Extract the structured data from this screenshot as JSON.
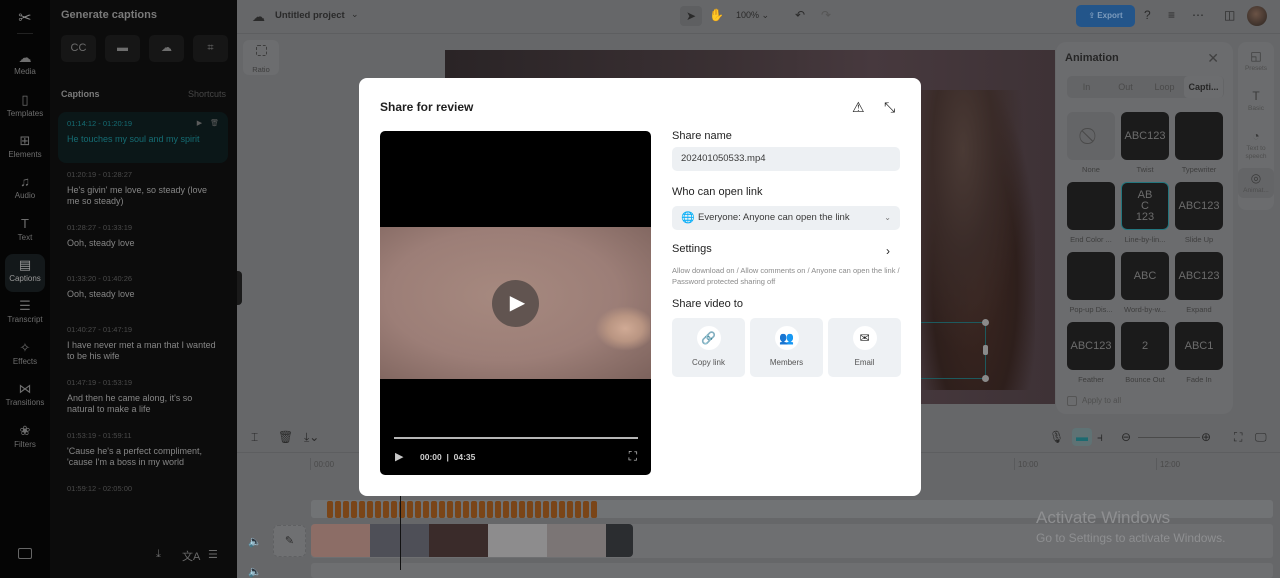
{
  "rail": {
    "items": [
      {
        "label": "Media",
        "icon": "media-upload-icon",
        "glyph": "☁"
      },
      {
        "label": "Templates",
        "icon": "templates-icon",
        "glyph": "▯"
      },
      {
        "label": "Elements",
        "icon": "elements-icon",
        "glyph": "⊞"
      },
      {
        "label": "Audio",
        "icon": "audio-icon",
        "glyph": "♫"
      },
      {
        "label": "Text",
        "icon": "text-icon",
        "glyph": "T"
      },
      {
        "label": "Captions",
        "icon": "captions-icon",
        "glyph": "▤",
        "active": true
      },
      {
        "label": "Transcript",
        "icon": "transcript-icon",
        "glyph": "☰"
      },
      {
        "label": "Effects",
        "icon": "effects-icon",
        "glyph": "✧"
      },
      {
        "label": "Transitions",
        "icon": "transitions-icon",
        "glyph": "⋈"
      },
      {
        "label": "Filters",
        "icon": "filters-icon",
        "glyph": "❀"
      }
    ]
  },
  "captions_panel": {
    "title": "Generate captions",
    "gen_buttons": [
      {
        "icon": "auto-captions-icon",
        "glyph": "CC"
      },
      {
        "icon": "manual-captions-icon",
        "glyph": "▬"
      },
      {
        "icon": "upload-captions-icon",
        "glyph": "☁"
      },
      {
        "icon": "scan-captions-icon",
        "glyph": "⌗"
      }
    ],
    "heading": "Captions",
    "shortcuts": "Shortcuts",
    "items": [
      {
        "time": "01:14:12 - 01:20:19",
        "text": "He touches my soul and my spirit",
        "active": true
      },
      {
        "time": "01:20:19 - 01:28:27",
        "text": "He's givin' me love, so steady (love me so steady)"
      },
      {
        "time": "01:28:27 - 01:33:19",
        "text": "Ooh, steady love"
      },
      {
        "time": "01:33:20 - 01:40:26",
        "text": "Ooh, steady love"
      },
      {
        "time": "01:40:27 - 01:47:19",
        "text": "I have never met a man that I wanted to be his wife"
      },
      {
        "time": "01:47:19 - 01:53:19",
        "text": "And then he came along, it's so natural to make a life"
      },
      {
        "time": "01:53:19 - 01:59:11",
        "text": "'Cause he's a perfect compliment, 'cause I'm a boss in my world"
      },
      {
        "time": "01:59:12 - 02:05:00",
        "text": ""
      }
    ],
    "play_glyph": "▶",
    "delete_glyph": "🗑"
  },
  "topbar": {
    "project_name": "Untitled project",
    "zoom": "100%",
    "export_label": "Export"
  },
  "canvas": {
    "ratio_label": "Ratio"
  },
  "animation_panel": {
    "title": "Animation",
    "tabs": [
      "In",
      "Out",
      "Loop",
      "Capti..."
    ],
    "active_tab": 3,
    "tiles": [
      {
        "label": "None",
        "preview": "⃠"
      },
      {
        "label": "Twist",
        "preview": "ABC123"
      },
      {
        "label": "Typewriter",
        "preview": ""
      },
      {
        "label": "End Color ...",
        "preview": ""
      },
      {
        "label": "Line-by-lin...",
        "preview": "AB\nC\n123",
        "selected": true
      },
      {
        "label": "Slide Up",
        "preview": "ABC123"
      },
      {
        "label": "Pop-up Dis...",
        "preview": ""
      },
      {
        "label": "Word-by-w...",
        "preview": "ABC"
      },
      {
        "label": "Expand",
        "preview": "ABC123"
      },
      {
        "label": "Feather",
        "preview": "ABC123"
      },
      {
        "label": "Bounce Out",
        "preview": "2"
      },
      {
        "label": "Fade In",
        "preview": "ABC1"
      }
    ],
    "apply_all": "Apply to all"
  },
  "right_tools": [
    {
      "label": "Presets",
      "icon": "presets-icon",
      "glyph": "◱"
    },
    {
      "label": "Basic",
      "icon": "basic-text-icon",
      "glyph": "T"
    },
    {
      "label": "Text to speech",
      "icon": "text-to-speech-icon",
      "glyph": "◔"
    },
    {
      "label": "Animat...",
      "icon": "animation-icon",
      "glyph": "◎",
      "active": true
    }
  ],
  "timeline": {
    "ticks": [
      "00:00",
      "10:00",
      "12:00"
    ]
  },
  "watermark": {
    "line1": "Activate Windows",
    "line2": "Go to Settings to activate Windows."
  },
  "modal": {
    "title": "Share for review",
    "player": {
      "current_time": "00:00",
      "duration": "04:35",
      "separator": "|"
    },
    "share_name_label": "Share name",
    "share_name_value": "202401050533.mp4",
    "who_label": "Who can open link",
    "who_value": "Everyone: Anyone can open the link",
    "settings_label": "Settings",
    "settings_desc": "Allow download on / Allow comments on / Anyone can open the link / Password protected sharing off",
    "share_to_label": "Share video to",
    "share_options": [
      {
        "label": "Copy link",
        "icon": "link-icon",
        "glyph": "🔗"
      },
      {
        "label": "Members",
        "icon": "members-icon",
        "glyph": "👥"
      },
      {
        "label": "Email",
        "icon": "email-icon",
        "glyph": "✉"
      }
    ]
  },
  "colors": {
    "accent_teal": "#156c73",
    "export_blue": "#23558a",
    "caption_clip": "#7a4518"
  }
}
